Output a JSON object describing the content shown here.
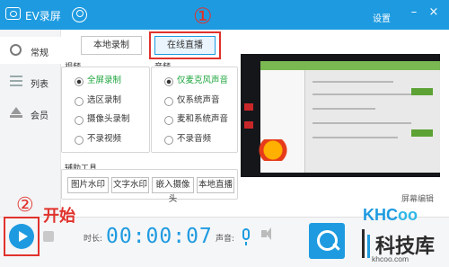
{
  "window": {
    "title": "EV录屏",
    "settings": "设置",
    "minimize": "–",
    "close": "×"
  },
  "sidebar": {
    "items": [
      {
        "label": "常规",
        "icon": "gear-icon"
      },
      {
        "label": "列表",
        "icon": "list-icon"
      },
      {
        "label": "会员",
        "icon": "crown-icon"
      }
    ]
  },
  "modes": {
    "local": "本地录制",
    "live": "在线直播",
    "selected": "在线直播"
  },
  "annotations": {
    "one": "①",
    "two": "②",
    "start": "开始"
  },
  "video": {
    "title": "视频",
    "options": [
      "全屏录制",
      "选区录制",
      "摄像头录制",
      "不录视频"
    ],
    "selected": "全屏录制"
  },
  "audio": {
    "title": "音频",
    "options": [
      "仅麦克风声音",
      "仅系统声音",
      "麦和系统声音",
      "不录音频"
    ],
    "selected": "仅麦克风声音"
  },
  "tools": {
    "title": "辅助工具",
    "buttons": [
      "图片水印",
      "文字水印",
      "嵌入摄像头",
      "本地直播"
    ]
  },
  "preview": {
    "edit_label": "屏幕编辑"
  },
  "bottom": {
    "duration_label": "时长:",
    "timer": "00:00:07",
    "volume_label": "声音:"
  },
  "watermark": {
    "logo_prefix": "KHC",
    "logo_suffix": "oo",
    "site_name": "科技库",
    "site_url": "khcoo.com"
  },
  "colors": {
    "accent": "#1e9be0",
    "annotation": "#e0322c",
    "selected_option": "#1ea53e"
  }
}
